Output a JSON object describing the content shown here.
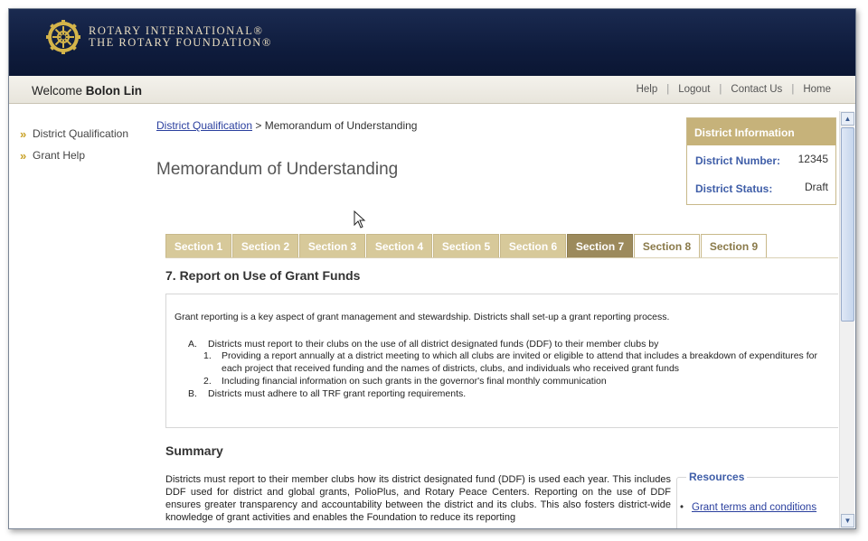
{
  "brand": {
    "line1": "ROTARY INTERNATIONAL®",
    "line2": "THE ROTARY FOUNDATION®"
  },
  "header": {
    "welcome_prefix": "Welcome",
    "user_name": "Bolon Lin",
    "links": [
      "Help",
      "Logout",
      "Contact Us",
      "Home"
    ]
  },
  "sidebar": {
    "items": [
      "District Qualification",
      "Grant Help"
    ]
  },
  "breadcrumb": {
    "parent": "District Qualification",
    "separator": " > ",
    "current": "Memorandum of Understanding"
  },
  "page_title": "Memorandum of Understanding",
  "district_info": {
    "title": "District Information",
    "number_label": "District Number:",
    "number_value": "12345",
    "status_label": "District Status:",
    "status_value": "Draft"
  },
  "tabs": [
    {
      "label": "Section 1",
      "state": "done"
    },
    {
      "label": "Section 2",
      "state": "done"
    },
    {
      "label": "Section 3",
      "state": "done"
    },
    {
      "label": "Section 4",
      "state": "done"
    },
    {
      "label": "Section 5",
      "state": "done"
    },
    {
      "label": "Section 6",
      "state": "done"
    },
    {
      "label": "Section 7",
      "state": "active"
    },
    {
      "label": "Section 8",
      "state": "future"
    },
    {
      "label": "Section 9",
      "state": "future"
    }
  ],
  "section": {
    "heading": "7. Report on Use of Grant Funds",
    "intro": "Grant reporting is a key aspect of grant management and stewardship. Districts shall set-up a grant reporting process.",
    "item_a_marker": "A.",
    "item_a": "Districts must report to their clubs on the use of all district designated funds (DDF) to their member clubs by",
    "sub1_marker": "1.",
    "sub1": "Providing a report annually at a district meeting to which all clubs are invited or eligible to attend that includes a breakdown of expenditures for each project that received funding and the names of districts, clubs, and individuals who received grant funds",
    "sub2_marker": "2.",
    "sub2": "Including financial information on such grants in the governor's final monthly communication",
    "item_b_marker": "B.",
    "item_b": "Districts must adhere to all TRF grant reporting requirements."
  },
  "summary": {
    "heading": "Summary",
    "text": "Districts must report to their member clubs how its district designated fund (DDF) is used each year. This includes DDF used for district and global grants, PolioPlus, and Rotary Peace Centers. Reporting on the use of DDF ensures greater transparency and accountability between the district and its clubs. This also fosters district-wide knowledge of grant activities and enables the Foundation to reduce its reporting"
  },
  "resources": {
    "title": "Resources",
    "link": "Grant terms and conditions"
  },
  "colors": {
    "banner": "#0f1c3d",
    "gold": "#c6b27a",
    "tab_active": "#9c8a5c",
    "label_blue": "#3f5ea8",
    "link_blue": "#2a3f9e"
  }
}
